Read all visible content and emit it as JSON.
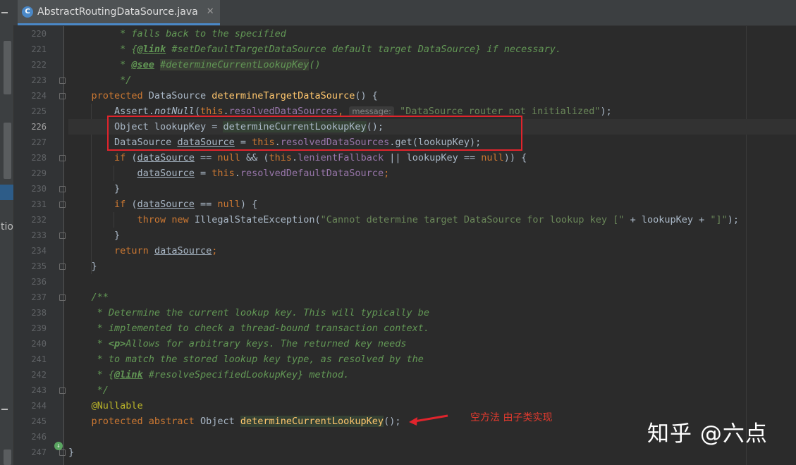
{
  "tab": {
    "file_name": "AbstractRoutingDataSource.java",
    "icon_letter": "C",
    "close": "✕"
  },
  "side": {
    "clipped_text": "tio"
  },
  "gutter": {
    "lines": [
      "220",
      "221",
      "222",
      "223",
      "224",
      "225",
      "226",
      "227",
      "228",
      "229",
      "230",
      "231",
      "232",
      "233",
      "234",
      "235",
      "236",
      "237",
      "238",
      "239",
      "240",
      "241",
      "242",
      "243",
      "244",
      "245",
      "246",
      "247"
    ],
    "current": "226"
  },
  "code": {
    "l220": {
      "text": " * falls back to the specified"
    },
    "l221": {
      "a": " * {",
      "tag": "@link",
      "b": " #setDefaultTargetDataSource default target DataSource} if necessary."
    },
    "l222": {
      "a": " * ",
      "tag": "@see",
      "b": " ",
      "ref": "#determineCurrentLookupKey",
      "c": "()"
    },
    "l223": {
      "text": " */"
    },
    "l224": {
      "kw": "protected",
      "type": " DataSource ",
      "fn": "determineTargetDataSource",
      "rest": "() {"
    },
    "l225": {
      "cls": "Assert.",
      "method": "notNull",
      "p1": "(",
      "this": "this",
      "dot": ".",
      "field": "resolvedDataSources",
      "comma": ",",
      "hint": "message:",
      "str": "\"DataSource router not initialized\"",
      "end": ");"
    },
    "l226": {
      "a": "Object lookupKey = ",
      "call": "determineCurrentLookupKey",
      "b": "();"
    },
    "l227": {
      "a": "DataSource ",
      "var": "dataSource",
      "b": " = ",
      "this": "this",
      "dot": ".",
      "field": "resolvedDataSources",
      "c": ".get(lookupKey);"
    },
    "l228": {
      "kw": "if",
      "p": " (",
      "var": "dataSource",
      "eq": " == ",
      "null": "null",
      "and": " && (",
      "this": "this",
      "dot": ".",
      "field": "lenientFallback",
      "or": " || lookupKey == ",
      "null2": "null",
      "end": ")) {"
    },
    "l229": {
      "var": "dataSource",
      "eq": " = ",
      "this": "this",
      "dot": ".",
      "field": "resolvedDefaultDataSource",
      "semi": ";"
    },
    "l230": {
      "text": "}"
    },
    "l231": {
      "kw": "if",
      "p": " (",
      "var": "dataSource",
      "eq": " == ",
      "null": "null",
      "end": ") {"
    },
    "l232": {
      "throw": "throw",
      "sp": " ",
      "new": "new",
      "a": " IllegalStateException(",
      "str1": "\"Cannot determine target DataSource for lookup key [\"",
      "b": " + lookupKey + ",
      "str2": "\"]\"",
      "end": ");"
    },
    "l233": {
      "text": "}"
    },
    "l234": {
      "kw": "return",
      "sp": " ",
      "var": "dataSource",
      "semi": ";"
    },
    "l235": {
      "text": "}"
    },
    "l237": {
      "text": "/**"
    },
    "l238": {
      "text": " * Determine the current lookup key. This will typically be"
    },
    "l239": {
      "text": " * implemented to check a thread-bound transaction context."
    },
    "l240": {
      "a": " * ",
      "tag": "<p>",
      "b": "Allows for arbitrary keys. The returned key needs"
    },
    "l241": {
      "text": " * to match the stored lookup key type, as resolved by the"
    },
    "l242": {
      "a": " * {",
      "tag": "@link",
      "b": " #resolveSpecifiedLookupKey} method."
    },
    "l243": {
      "text": " */"
    },
    "l244": {
      "text": "@Nullable"
    },
    "l245": {
      "kw": "protected abstract",
      "type": " Object ",
      "fn": "determineCurrentLookupKey",
      "rest": "();"
    },
    "l247": {
      "text": "}"
    }
  },
  "annotation": {
    "note": "空方法 由子类实现",
    "box_color": "#e0242c"
  },
  "watermark": "知乎 @六点"
}
